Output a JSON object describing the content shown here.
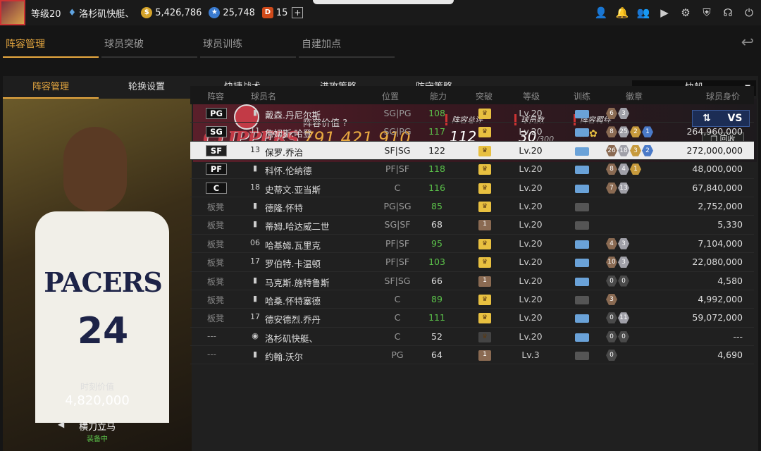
{
  "topbar": {
    "level_label": "等级20",
    "team_name": "洛杉矶快艇、",
    "coins": "5,426,786",
    "stars": "25,748",
    "tickets": "15",
    "plus": "+",
    "icons": [
      "person-icon",
      "bell-icon",
      "friends-icon",
      "video-icon",
      "gear-icon",
      "shield-icon",
      "headset-icon",
      "power-icon"
    ]
  },
  "main_tabs": [
    "阵容管理",
    "球员突破",
    "球员训练",
    "自建加点"
  ],
  "sub_tabs": [
    "阵容管理",
    "轮换设置",
    "快捷战术",
    "进攻策略",
    "防守策略"
  ],
  "dropdown": {
    "selected": "快船"
  },
  "team": {
    "logo_word": "CLIPPERS",
    "value_label": "阵容价值",
    "value": "791,421,910",
    "overall_label": "阵容总评",
    "overall": "112",
    "count_label": "球员数",
    "count": "30",
    "count_max": "/300",
    "chem_label": "阵容羁绊",
    "btn_pick": "选拔",
    "btn_recycle": "回收"
  },
  "hero": {
    "jersey_text": "PACERS",
    "jersey_number": "24",
    "value_label": "时刻价值",
    "value": "4,820,000",
    "name": "横刀立马",
    "status": "装备中"
  },
  "table": {
    "headers": [
      "阵容",
      "球员名",
      "位置",
      "能力",
      "突破",
      "等级",
      "训练",
      "徽章",
      "球员身价"
    ],
    "rows": [
      {
        "slot": "PG",
        "num": "▮",
        "name": "戴森.丹尼尔斯",
        "pos": "SG|PG",
        "ability": "108",
        "lvl": "Lv.20",
        "salary": "",
        "badges": [
          "6",
          "3"
        ],
        "vs": true
      },
      {
        "slot": "SG",
        "num": "11",
        "name": "詹姆斯.哈登",
        "pos": "SG|PG",
        "ability": "117",
        "lvl": "Lv.20",
        "salary": "264,960,000",
        "badges": [
          "8",
          "25",
          "2",
          "1"
        ]
      },
      {
        "slot": "SF",
        "num": "13",
        "name": "保罗.乔治",
        "pos": "SF|SG",
        "ability": "122",
        "lvl": "Lv.20",
        "salary": "272,000,000",
        "badges": [
          "26",
          "18",
          "3",
          "2"
        ],
        "selected": true
      },
      {
        "slot": "PF",
        "num": "▮",
        "name": "科怀.伦纳德",
        "pos": "PF|SF",
        "ability": "118",
        "lvl": "Lv.20",
        "salary": "48,000,000",
        "badges": [
          "8",
          "4",
          "1"
        ]
      },
      {
        "slot": "C",
        "num": "18",
        "name": "史蒂文.亚当斯",
        "pos": "C",
        "ability": "116",
        "lvl": "Lv.20",
        "salary": "67,840,000",
        "badges": [
          "7",
          "13"
        ]
      },
      {
        "slot": "板凳",
        "num": "▮",
        "name": "德隆.怀特",
        "pos": "PG|SG",
        "ability": "85",
        "lvl": "Lv.20",
        "salary": "2,752,000",
        "badges": []
      },
      {
        "slot": "板凳",
        "num": "▮",
        "name": "蒂姆.哈达威二世",
        "pos": "SG|SF",
        "ability": "68",
        "lvl": "Lv.20",
        "salary": "5,330",
        "badges": [],
        "brk": "1"
      },
      {
        "slot": "板凳",
        "num": "06",
        "name": "哈基姆.瓦里克",
        "pos": "PF|SF",
        "ability": "95",
        "lvl": "Lv.20",
        "salary": "7,104,000",
        "badges": [
          "4",
          "3"
        ]
      },
      {
        "slot": "板凳",
        "num": "17",
        "name": "罗伯特.卡温顿",
        "pos": "PF|SF",
        "ability": "103",
        "lvl": "Lv.20",
        "salary": "22,080,000",
        "badges": [
          "10",
          "3"
        ]
      },
      {
        "slot": "板凳",
        "num": "▮",
        "name": "马克斯.施特鲁斯",
        "pos": "SF|SG",
        "ability": "66",
        "lvl": "Lv.20",
        "salary": "4,580",
        "badges": [
          "0",
          "0"
        ],
        "brk": "1"
      },
      {
        "slot": "板凳",
        "num": "▮",
        "name": "哈桑.怀特塞德",
        "pos": "C",
        "ability": "89",
        "lvl": "Lv.20",
        "salary": "4,992,000",
        "badges": [
          "3"
        ]
      },
      {
        "slot": "板凳",
        "num": "17",
        "name": "德安德烈.乔丹",
        "pos": "C",
        "ability": "111",
        "lvl": "Lv.20",
        "salary": "59,072,000",
        "badges": [
          "0",
          "11"
        ]
      },
      {
        "slot": "---",
        "num": "◉",
        "name": "洛杉矶快艇、",
        "pos": "C",
        "ability": "52",
        "lvl": "Lv.20",
        "salary": "---",
        "badges": [
          "0",
          "0"
        ],
        "brk": ""
      },
      {
        "slot": "---",
        "num": "▮",
        "name": "约翰.沃尔",
        "pos": "PG",
        "ability": "64",
        "lvl": "Lv.3",
        "salary": "4,690",
        "badges": [
          "0"
        ],
        "brk": "1"
      }
    ]
  },
  "vs_label": "VS",
  "colors": {
    "accent": "#e8a940",
    "green": "#5bc24a",
    "panel": "#202020"
  }
}
